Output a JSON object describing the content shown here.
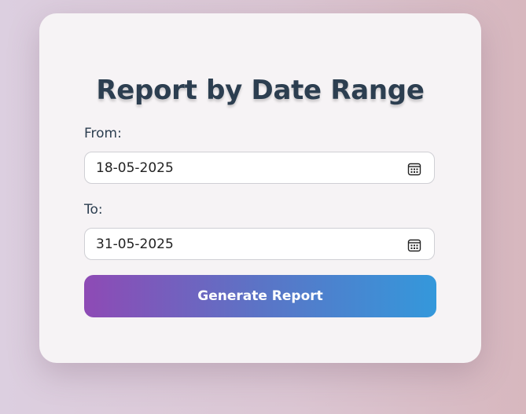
{
  "form": {
    "title": "Report by Date Range",
    "from": {
      "label": "From:",
      "value": "18-05-2025",
      "icon": "calendar-icon"
    },
    "to": {
      "label": "To:",
      "value": "31-05-2025",
      "icon": "calendar-icon"
    },
    "submit_label": "Generate Report"
  },
  "colors": {
    "title": "#2c3e50",
    "button_gradient_start": "#8e4ab5",
    "button_gradient_end": "#3498db",
    "card_background": "#f6f3f5"
  }
}
